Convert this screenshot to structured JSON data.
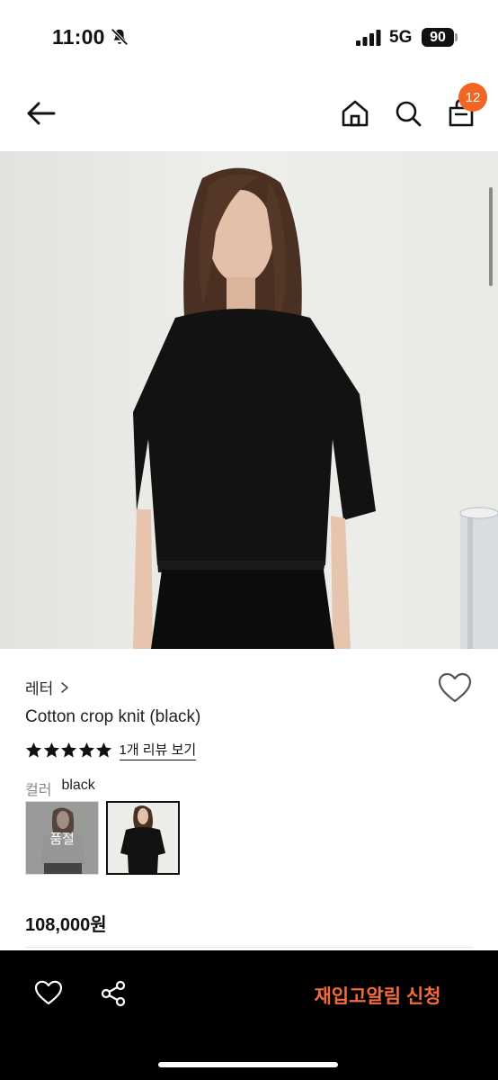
{
  "status_bar": {
    "time": "11:00",
    "network": "5G",
    "battery": "90",
    "icons": [
      "bell-slash-icon",
      "signal-bars-icon"
    ]
  },
  "header": {
    "cart_count": "12",
    "icons": [
      "arrow-left-icon",
      "home-icon",
      "search-icon",
      "shopping-bag-icon"
    ]
  },
  "product": {
    "brand": "레터",
    "brand_chevron": "›",
    "name": "Cotton crop knit (black)",
    "rating_stars": 5,
    "review_link": "1개 리뷰 보기",
    "color_label": "컬러",
    "color_value": "black",
    "swatches": [
      {
        "status": "품절",
        "selected": false
      },
      {
        "status": "",
        "selected": true
      }
    ],
    "price": "108,000원"
  },
  "bottom_bar": {
    "restock_label": "재입고알림 신청",
    "icons": [
      "heart-outline-icon",
      "share-icon"
    ]
  },
  "colors": {
    "accent": "#f26522",
    "restock_text": "#f36b3a",
    "bottom_bar_bg": "#000000"
  }
}
